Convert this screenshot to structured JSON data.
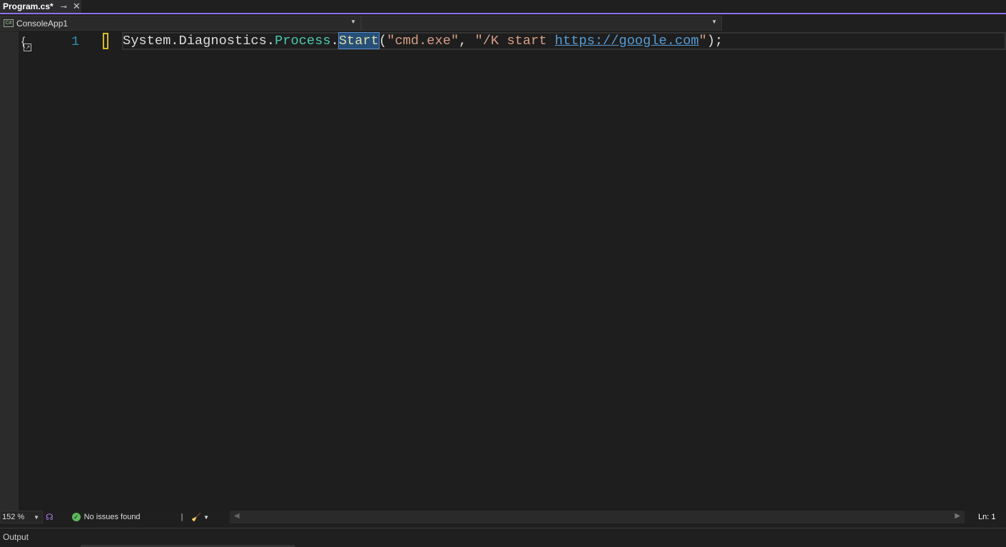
{
  "tab": {
    "title": "Program.cs*",
    "pin_icon": "pin-icon",
    "close_icon": "close-icon"
  },
  "navbar": {
    "project": "ConsoleApp1",
    "project_icon_text": "C#"
  },
  "editor": {
    "line_number": "1",
    "code_tokens": [
      {
        "text": "System.Diagnostics.",
        "kind": "plain"
      },
      {
        "text": "Process",
        "kind": "class"
      },
      {
        "text": ".",
        "kind": "plain"
      },
      {
        "text": "Start",
        "kind": "method"
      },
      {
        "text": "(",
        "kind": "plain"
      },
      {
        "text": "\"cmd.exe\"",
        "kind": "string"
      },
      {
        "text": ", ",
        "kind": "plain"
      },
      {
        "text": "\"/K start ",
        "kind": "string"
      },
      {
        "text": "https://google.com",
        "kind": "url"
      },
      {
        "text": "\"",
        "kind": "string"
      },
      {
        "text": ");",
        "kind": "plain"
      }
    ]
  },
  "status": {
    "zoom": "152 %",
    "issues": "No issues found",
    "position": "Ln: 1"
  },
  "output": {
    "title": "Output"
  },
  "colors": {
    "accent": "#8c6fe6",
    "class": "#4ec9b0",
    "string": "#d69d85",
    "url": "#569cd6",
    "line_number": "#2b91af"
  }
}
